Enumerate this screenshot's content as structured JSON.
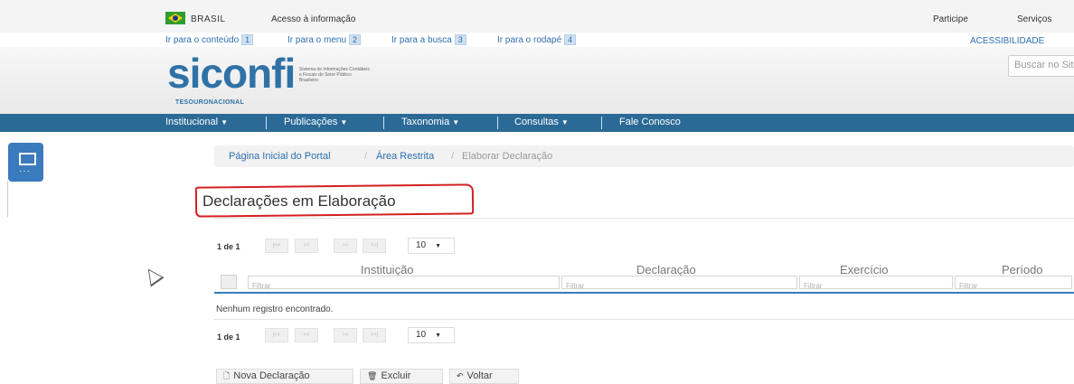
{
  "govbar": {
    "brasil": "BRASIL",
    "acesso": "Acesso à informação",
    "participe": "Participe",
    "servicos": "Serviços"
  },
  "accessibility": {
    "links": [
      {
        "label": "Ir para o conteúdo",
        "key": "1"
      },
      {
        "label": "Ir para o menu",
        "key": "2"
      },
      {
        "label": "Ir para a busca",
        "key": "3"
      },
      {
        "label": "Ir para o rodapé",
        "key": "4"
      }
    ],
    "acessibilidade": "ACESSIBILIDADE"
  },
  "header": {
    "logo": "siconfi",
    "logo_sub": "Sistema de Informações Contábeis e Fiscais do Setor Público Brasileiro",
    "tesouro": "TESOURONACIONAL",
    "search_placeholder": "Buscar no Site"
  },
  "nav": {
    "items": [
      "Institucional",
      "Publicações",
      "Taxonomia",
      "Consultas",
      "Fale Conosco"
    ]
  },
  "breadcrumb": {
    "home": "Página Inicial do Portal",
    "area": "Área Restrita",
    "current": "Elaborar Declaração",
    "separator": "/"
  },
  "page": {
    "title": "Declarações em Elaboração"
  },
  "paginator": {
    "label": "1 de 1",
    "rows_per_page": "10",
    "first": "|<<",
    "prev": "<<",
    "next": ">>",
    "last": ">>|"
  },
  "table": {
    "columns": [
      "Instituição",
      "Declaração",
      "Exercício",
      "Período"
    ],
    "filter_placeholder": "Filtrar",
    "empty_message": "Nenhum registro encontrado."
  },
  "actions": {
    "new": "Nova Declaração",
    "delete": "Excluir",
    "back": "Voltar"
  },
  "colors": {
    "nav_bg": "#2b6a96",
    "link": "#2c6fb0",
    "highlight_annotation": "#d42020"
  }
}
